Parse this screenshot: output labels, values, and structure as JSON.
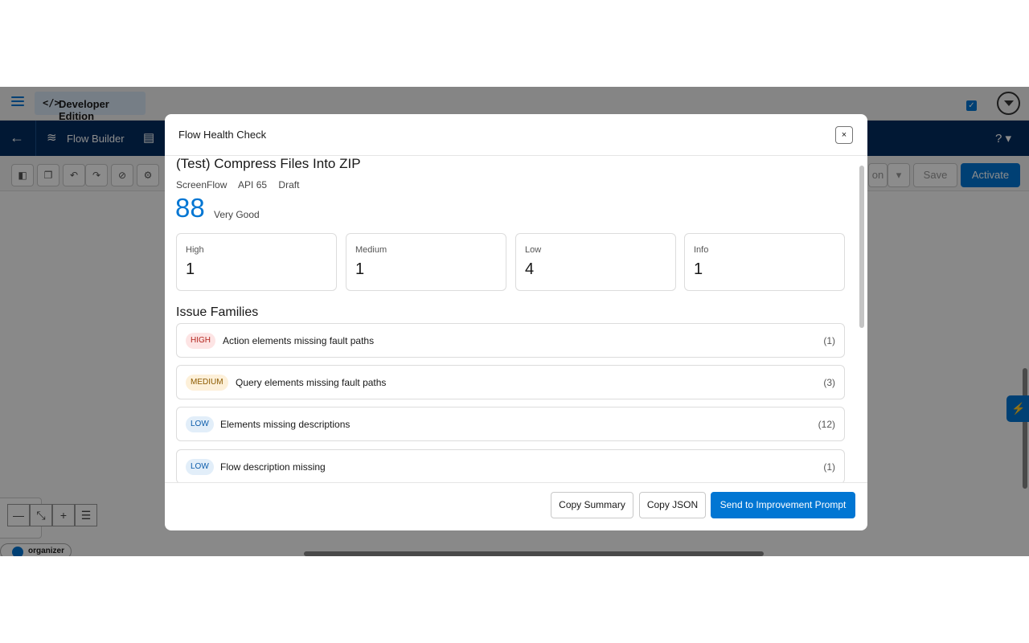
{
  "app": {
    "org_badge": "Developer Edition",
    "code_icon": "</>",
    "nav_title": "Flow Builder",
    "help_icon": "? ▾",
    "toolbar": {
      "save_label": "Save",
      "activate_label": "Activate",
      "partial_label": "on"
    },
    "organizer_label": "organizer"
  },
  "modal": {
    "title": "Flow Health Check",
    "close_label": "×",
    "flow_name": "(Test) Compress Files Into ZIP",
    "meta": {
      "type": "ScreenFlow",
      "api": "API 65",
      "status": "Draft"
    },
    "score": "88",
    "score_label": "Very Good",
    "cards": [
      {
        "label": "High",
        "value": "1"
      },
      {
        "label": "Medium",
        "value": "1"
      },
      {
        "label": "Low",
        "value": "4"
      },
      {
        "label": "Info",
        "value": "1"
      }
    ],
    "section_title": "Issue Families",
    "issues": [
      {
        "severity": "HIGH",
        "text": "Action elements missing fault paths",
        "count": "(1)"
      },
      {
        "severity": "MEDIUM",
        "text": "Query elements missing fault paths",
        "count": "(3)"
      },
      {
        "severity": "LOW",
        "text": "Elements missing descriptions",
        "count": "(12)"
      },
      {
        "severity": "LOW",
        "text": "Flow description missing",
        "count": "(1)"
      }
    ],
    "footer": {
      "copy_summary": "Copy Summary",
      "copy_json": "Copy JSON",
      "send_prompt": "Send to Improvement Prompt"
    }
  },
  "colors": {
    "brand": "#0176d3",
    "nav": "#032d60",
    "high": "#b3261e",
    "medium": "#8c5a00",
    "low": "#0b5cab"
  }
}
